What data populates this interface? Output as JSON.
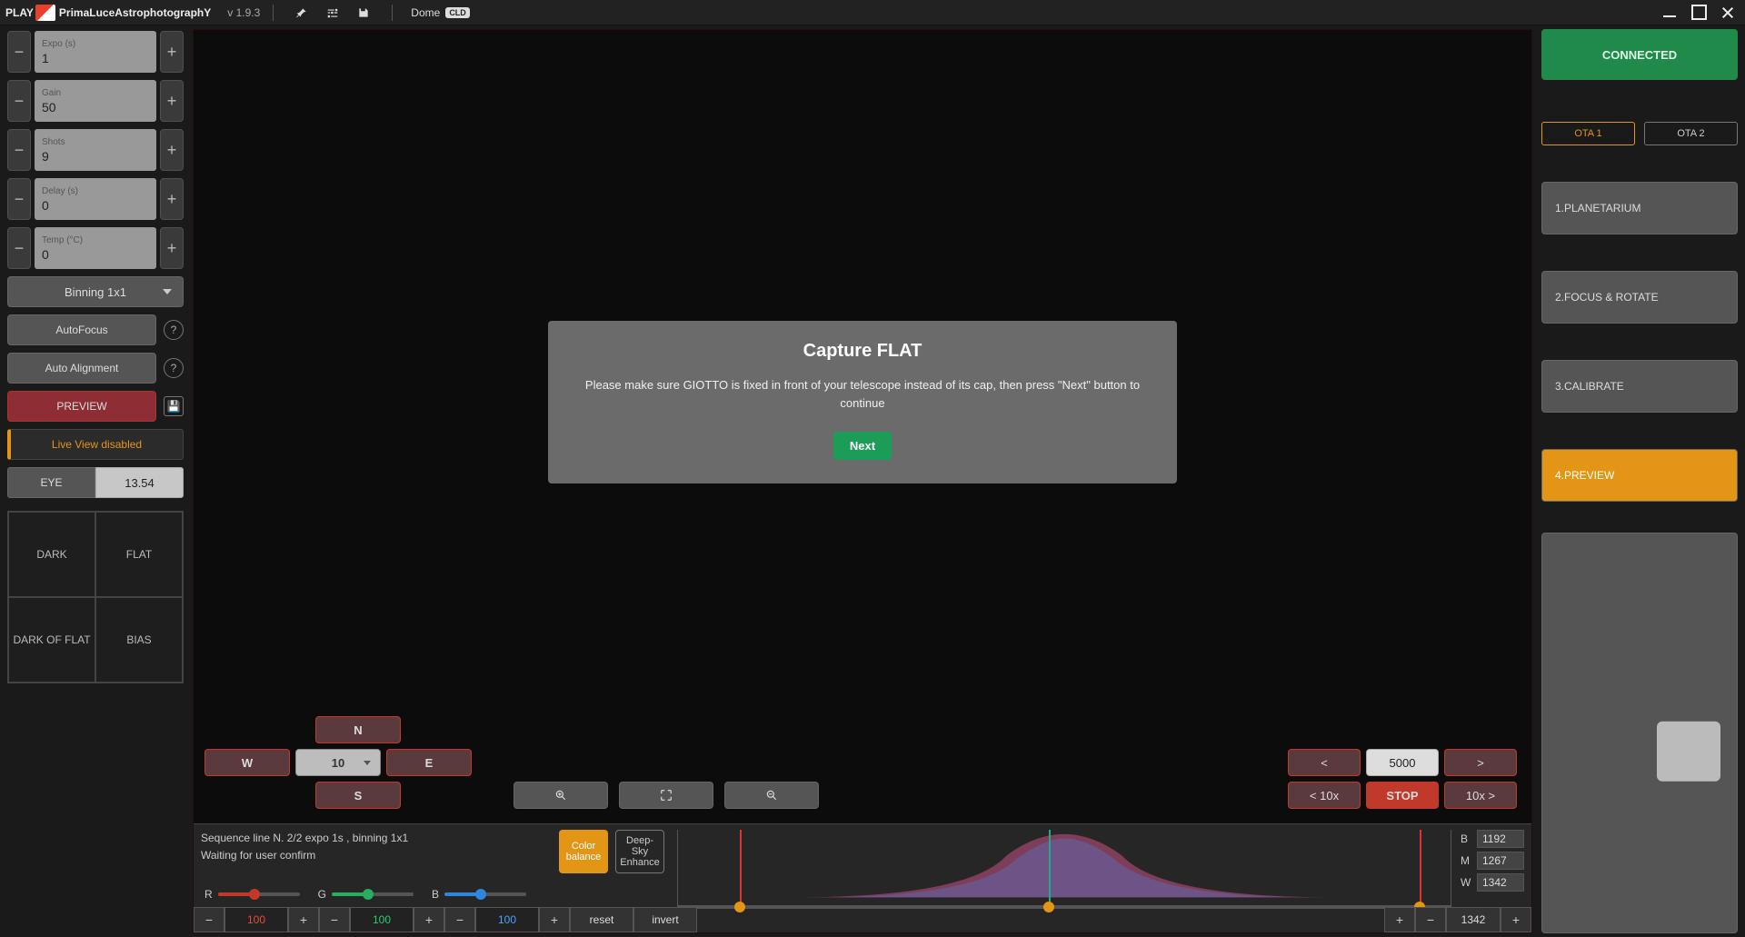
{
  "topbar": {
    "play": "PLAY",
    "title_html": "PrimaLuceAstrophotographY",
    "version": "v 1.9.3",
    "dome": "Dome",
    "cld": "CLD"
  },
  "left": {
    "expo": {
      "label": "Expo (s)",
      "value": "1"
    },
    "gain": {
      "label": "Gain",
      "value": "50"
    },
    "shots": {
      "label": "Shots",
      "value": "9"
    },
    "delay": {
      "label": "Delay (s)",
      "value": "0"
    },
    "temp": {
      "label": "Temp (°C)",
      "value": "0"
    },
    "binning": "Binning 1x1",
    "autofocus": "AutoFocus",
    "autoalign": "Auto Alignment",
    "preview": "PREVIEW",
    "liveview": "Live View disabled",
    "eye": "EYE",
    "eye_val": "13.54",
    "quad": {
      "dark": "DARK",
      "flat": "FLAT",
      "dof": "DARK OF FLAT",
      "bias": "BIAS"
    }
  },
  "center": {
    "dir": {
      "n": "N",
      "s": "S",
      "e": "E",
      "w": "W",
      "speed": "10"
    },
    "focus": {
      "lt": "<",
      "gt": ">",
      "val": "5000",
      "lt10": "< 10x",
      "stop": "STOP",
      "gt10": "10x >"
    },
    "status": {
      "line1": "Sequence line N. 2/2 expo 1s , binning 1x1",
      "line2": "Waiting for user confirm"
    },
    "colorbal": "Color balance",
    "deepsky": "Deep-Sky Enhance",
    "rgb": {
      "r": "R",
      "g": "G",
      "b": "B"
    },
    "adj": {
      "r": "100",
      "g": "100",
      "b": "100",
      "reset": "reset",
      "invert": "invert",
      "end": "1342"
    },
    "bmw": {
      "b": "1192",
      "m": "1267",
      "w": "1342"
    }
  },
  "right": {
    "connected": "CONNECTED",
    "ota1": "OTA 1",
    "ota2": "OTA 2",
    "nav": {
      "plan": "1.PLANETARIUM",
      "focus": "2.FOCUS & ROTATE",
      "calib": "3.CALIBRATE",
      "preview": "4.PREVIEW"
    }
  },
  "modal": {
    "title": "Capture FLAT",
    "body": "Please make sure GIOTTO is fixed in front of your telescope instead of its cap, then press \"Next\" button to continue",
    "next": "Next"
  }
}
